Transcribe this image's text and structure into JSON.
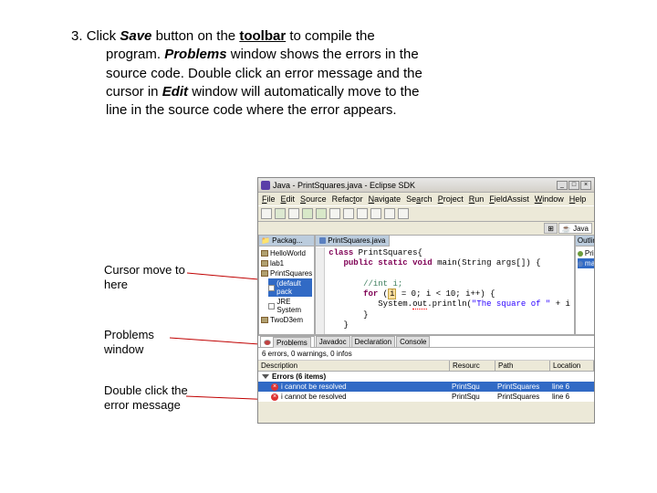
{
  "instruction": {
    "number": "3.",
    "parts": [
      "Click ",
      {
        "bold": true,
        "italic": true,
        "text": "Save"
      },
      " button on the ",
      {
        "bold": true,
        "underline": true,
        "text": "toolbar"
      },
      " to compile the program. ",
      {
        "bold": true,
        "italic": true,
        "text": "Problems"
      },
      " window shows the errors in the source code. Double click an error message and the cursor in ",
      {
        "bold": true,
        "italic": true,
        "text": "Edit"
      },
      " window will automatically move to the line in the source code where the error appears."
    ],
    "text_combined_1": "Click ",
    "save": "Save",
    "text_2": " button on the ",
    "toolbar": "toolbar",
    "text_3": " to compile the",
    "line2a": "program. ",
    "problems": "Problems",
    "line2b": " window shows the errors in the",
    "line3": "source code. Double click an error message and the",
    "line4a": "cursor in ",
    "edit": "Edit",
    "line4b": " window will automatically move to the",
    "line5": "line in the source code where the error appears."
  },
  "annotations": {
    "cursor_move": "Cursor move to here",
    "problems_window": "Problems window",
    "double_click": "Double click the error message"
  },
  "eclipse": {
    "title": "Java - PrintSquares.java - Eclipse SDK",
    "menu": [
      "File",
      "Edit",
      "Source",
      "Refactor",
      "Navigate",
      "Search",
      "Project",
      "Run",
      "FieldAssist",
      "Window",
      "Help"
    ],
    "perspective": "Java",
    "editor_tab": "PrintSquares.java",
    "package_explorer": {
      "items": [
        {
          "label": "HelloWorld",
          "level": 1,
          "sel": false,
          "type": "proj"
        },
        {
          "label": "lab1",
          "level": 1,
          "sel": false,
          "type": "proj"
        },
        {
          "label": "PrintSquares",
          "level": 1,
          "sel": false,
          "type": "proj"
        },
        {
          "label": "(default pack",
          "level": 2,
          "sel": true,
          "type": "pkg"
        },
        {
          "label": "JRE System",
          "level": 2,
          "sel": false,
          "type": "lib"
        },
        {
          "label": "TwoD3em",
          "level": 1,
          "sel": false,
          "type": "proj"
        }
      ]
    },
    "outline": {
      "label": "PrintS...",
      "items": [
        "PrintS",
        "mai"
      ]
    },
    "code": {
      "l1_a": "class ",
      "l1_b": "PrintSquares{",
      "l2_a": "public static void ",
      "l2_b": "main(String args[]) {",
      "l3": "//int i;",
      "l4_a": "for ",
      "l4_b": "(",
      "l4_c": "i",
      "l4_d": " = 0; i < 10; i++) {",
      "l5_a": "System.",
      "l5_b": "out",
      "l5_c": ".println(",
      "l5_d": "\"The square of \"",
      "l5_e": " + i",
      "l6": "}",
      "l7": "}"
    },
    "problems": {
      "tabs": [
        "Problems",
        "Javadoc",
        "Declaration",
        "Console"
      ],
      "summary": "6 errors, 0 warnings, 0 infos",
      "columns": [
        "Description",
        "Resourc",
        "Path",
        "Location"
      ],
      "group": "Errors (6 items)",
      "rows": [
        {
          "desc": "i cannot be resolved",
          "res": "PrintSqu",
          "path": "PrintSquares",
          "loc": "line 6",
          "sel": true
        },
        {
          "desc": "i cannot be resolved",
          "res": "PrintSqu",
          "path": "PrintSquares",
          "loc": "line 6",
          "sel": false
        }
      ]
    }
  }
}
